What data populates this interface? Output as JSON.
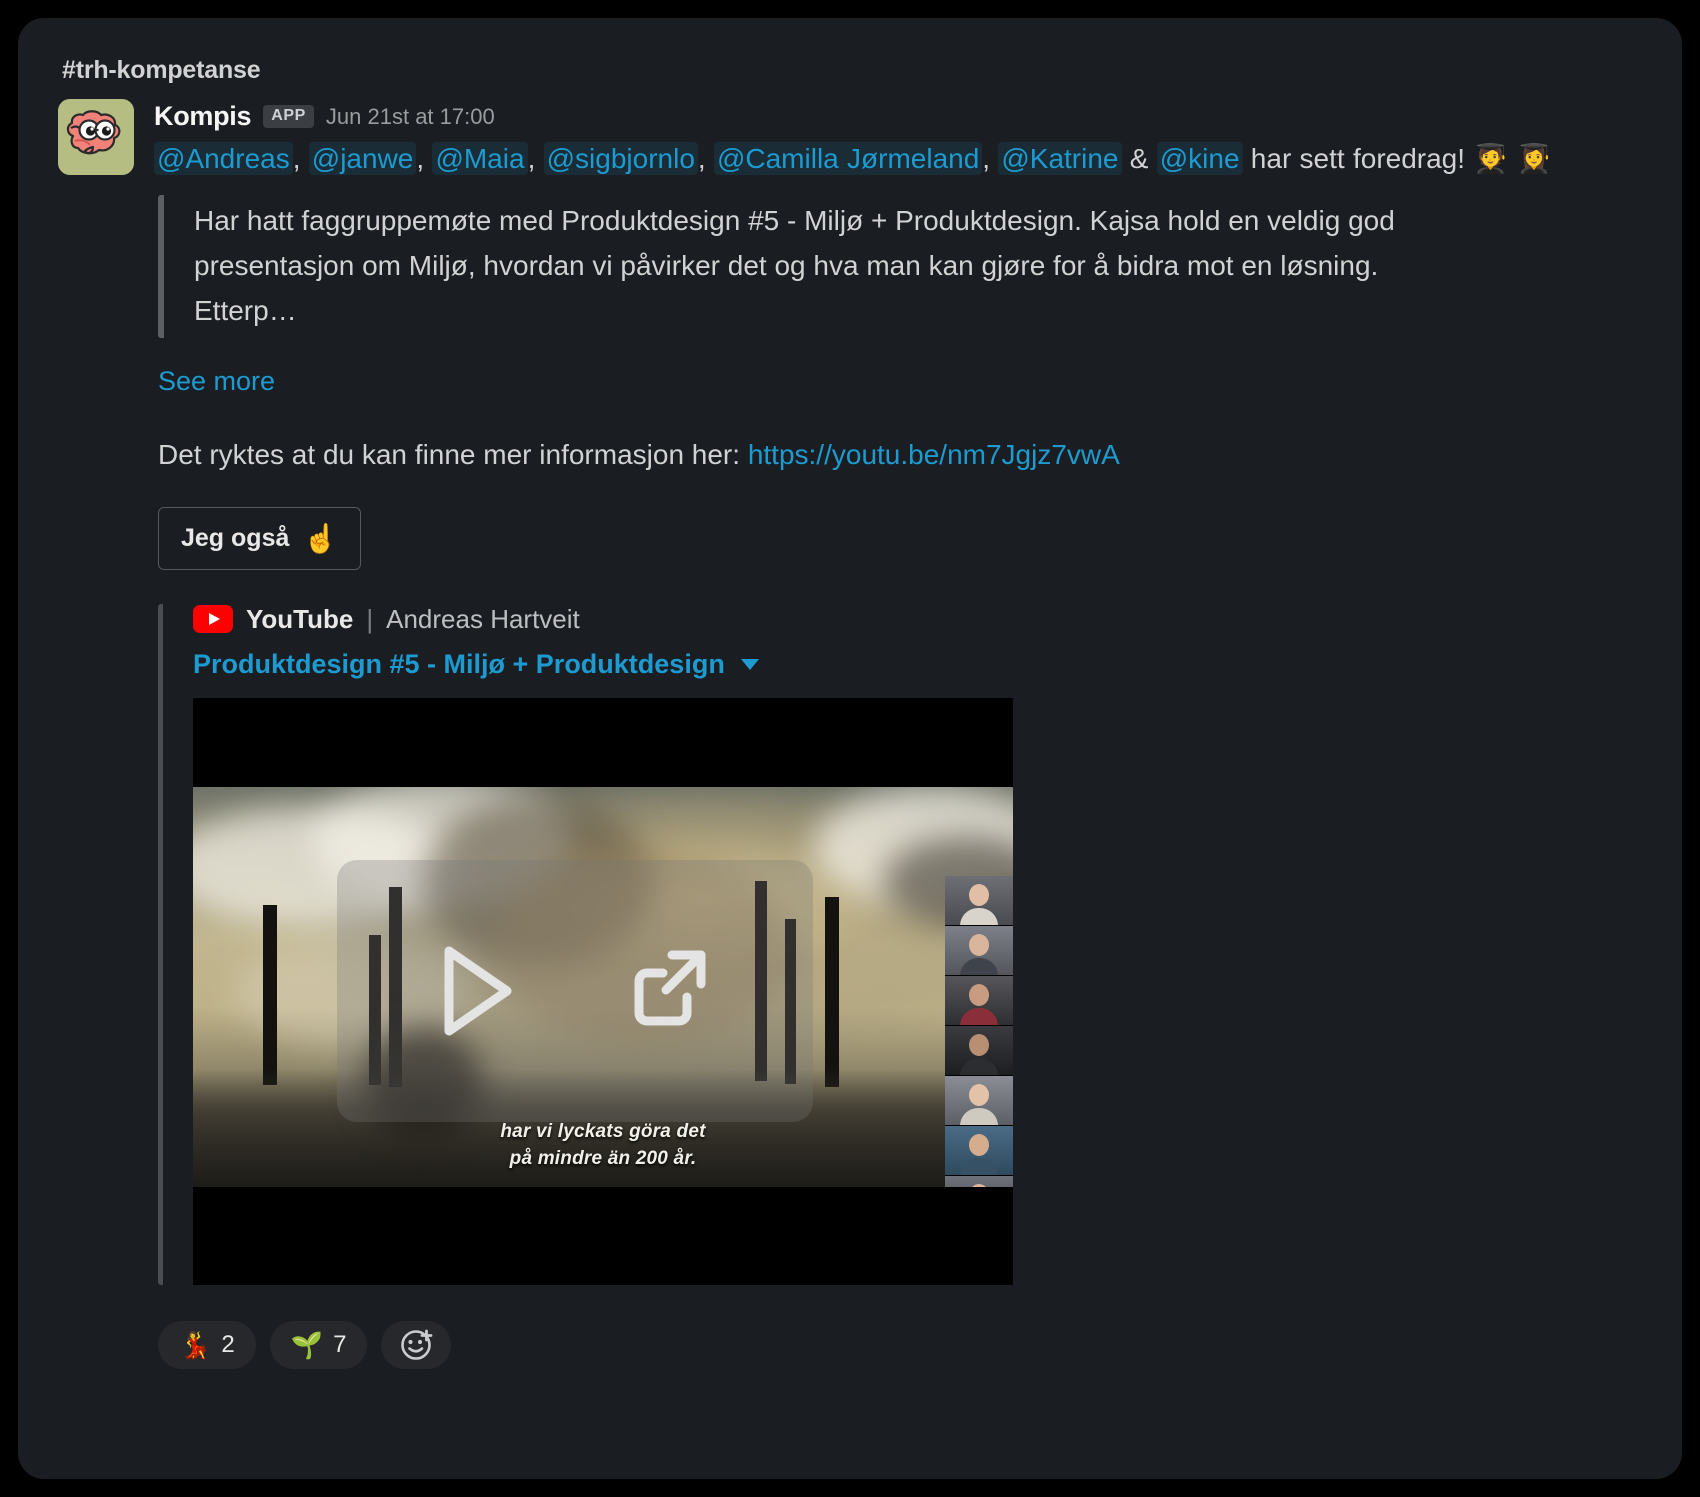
{
  "channel": {
    "name": "#trh-kompetanse"
  },
  "message": {
    "sender": "Kompis",
    "app_badge": "APP",
    "timestamp": "Jun 21st at 17:00",
    "avatar_icon": "brain-avatar",
    "mentions": [
      "@Andreas",
      "@janwe",
      "@Maia",
      "@sigbjornlo",
      "@Camilla Jørmeland",
      "@Katrine",
      "@kine"
    ],
    "mention_separator": ", ",
    "mention_last_separator": " & ",
    "mention_suffix": " har sett foredrag! ",
    "mention_emoji_1": "🧑‍🎓",
    "mention_emoji_2": "👩‍🎓",
    "quote": "Har hatt faggruppemøte med Produktdesign #5 - Miljø + Produktdesign. Kajsa hold en veldig god presentasjon om Miljø, hvordan vi påvirker det og hva man kan gjøre for å bidra mot en løsning. Etterp…",
    "see_more": "See more",
    "info_prefix": "Det ryktes at du kan finne mer informasjon her: ",
    "info_link": "https://youtu.be/nm7Jgjz7vwA",
    "action_button": {
      "label": "Jeg også",
      "emoji": "☝️"
    }
  },
  "unfurl": {
    "service": "YouTube",
    "separator": "|",
    "author": "Andreas Hartveit",
    "title": "Produktdesign #5 - Miljø + Produktdesign",
    "caret_icon": "chevron-down-icon",
    "thumbnail": {
      "subtitle_line_1": "har vi lyckats göra det",
      "subtitle_line_2": "på mindre än 200 år.",
      "play_icon": "play-icon",
      "open_external_icon": "open-external-icon"
    }
  },
  "reactions": [
    {
      "emoji": "💃",
      "count": "2",
      "name": "reaction-dancer"
    },
    {
      "emoji": "🌱",
      "count": "7",
      "name": "reaction-seedling"
    }
  ],
  "add_reaction_icon": "add-reaction-icon",
  "colors": {
    "link": "#1d9bd1",
    "panel": "#1a1d21",
    "youtube_red": "#ff0000",
    "avatar_bg": "#b5bd82",
    "text": "#d1d2d3"
  }
}
